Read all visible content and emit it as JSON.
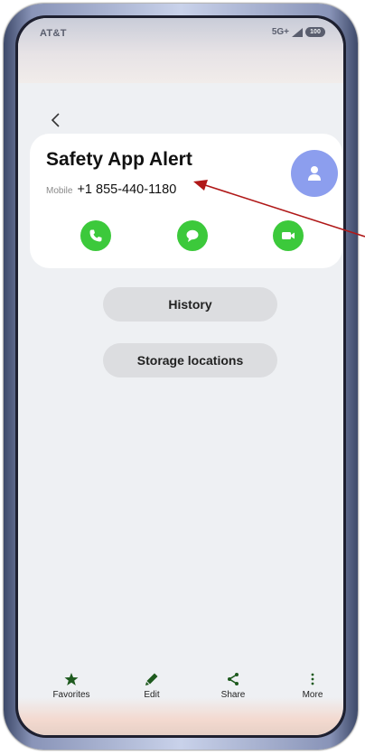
{
  "status_bar": {
    "carrier": "AT&T",
    "network": "5G+",
    "battery": "100"
  },
  "contact": {
    "name": "Safety App Alert",
    "number_type": "Mobile",
    "number": "+1 855-440-1180"
  },
  "actions": {
    "icons": [
      "phone-icon",
      "message-icon",
      "video-call-icon"
    ],
    "accent_color": "#3cc93b"
  },
  "buttons": {
    "history": "History",
    "storage": "Storage locations"
  },
  "bottom_nav": {
    "favorites": "Favorites",
    "edit": "Edit",
    "share": "Share",
    "more": "More",
    "icon_color": "#1e5a1e"
  },
  "annotation": {
    "arrow_color": "#b01818"
  }
}
